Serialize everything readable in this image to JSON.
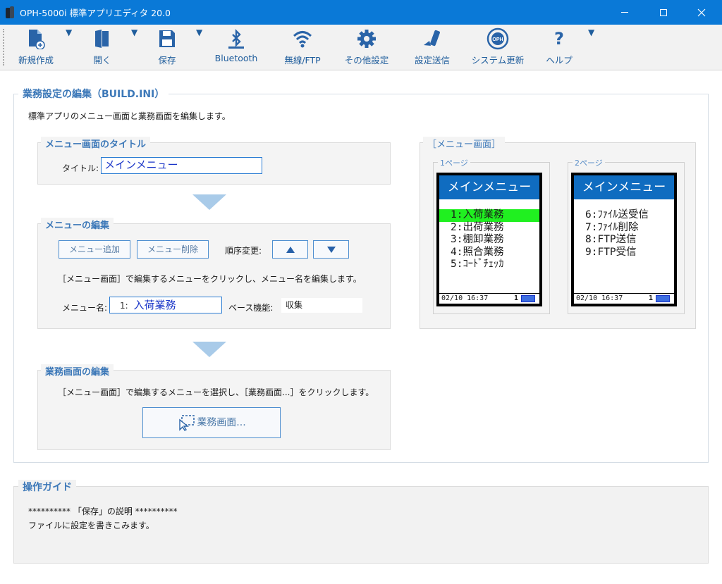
{
  "window": {
    "title": "OPH-5000i 標準アプリエディタ 20.0"
  },
  "toolbar": {
    "items": [
      {
        "label": "新規作成",
        "icon": "new-file-icon"
      },
      {
        "label": "開く",
        "icon": "open-icon"
      },
      {
        "label": "保存",
        "icon": "save-icon"
      },
      {
        "label": "Bluetooth",
        "icon": "bluetooth-icon"
      },
      {
        "label": "無線/FTP",
        "icon": "wifi-icon"
      },
      {
        "label": "その他設定",
        "icon": "gear-icon"
      },
      {
        "label": "設定送信",
        "icon": "send-icon"
      },
      {
        "label": "システム更新",
        "icon": "system-update-icon"
      },
      {
        "label": "ヘルプ",
        "icon": "help-icon"
      }
    ]
  },
  "main": {
    "title": "業務設定の編集（BUILD.INI）",
    "description": "標準アプリのメニュー画面と業務画面を編集します。"
  },
  "menu_title_section": {
    "title": "メニュー画面のタイトル",
    "label": "タイトル:",
    "value": "メインメニュー"
  },
  "menu_edit_section": {
    "title": "メニューの編集",
    "add_label": "メニュー追加",
    "delete_label": "メニュー削除",
    "order_label": "順序変更:",
    "instruction": "［メニュー画面］で編集するメニューをクリックし、メニュー名を編集します。",
    "name_label": "メニュー名:",
    "name_index": "1:",
    "name_value": "入荷業務",
    "base_label": "ベース機能:",
    "base_value": "収集"
  },
  "work_screen_section": {
    "title": "業務画面の編集",
    "instruction": "［メニュー画面］で編集するメニューを選択し、［業務画面...］をクリックします。",
    "button_label": "業務画面..."
  },
  "preview": {
    "title": "［メニュー画面］",
    "pages": [
      {
        "label": "1ページ",
        "header": "メインメニュー",
        "items": [
          "1:入荷業務",
          "2:出荷業務",
          "3:棚卸業務",
          "4:照合業務",
          "5:ｺｰﾄﾞﾁｪｯｶ"
        ],
        "footer": "02/10 16:37",
        "indicator": "1"
      },
      {
        "label": "2ページ",
        "header": "メインメニュー",
        "items": [
          "6:ﾌｧｲﾙ送受信",
          "7:ﾌｧｲﾙ削除",
          "8:FTP送信",
          "9:FTP受信"
        ],
        "footer": "02/10 16:37",
        "indicator": "1"
      }
    ]
  },
  "guide": {
    "title": "操作ガイド",
    "line1": "********** 「保存」の説明 **********",
    "line2": "ファイルに設定を書きこみます。"
  },
  "colors": {
    "accent": "#0a79d7",
    "label_blue": "#3c78b8",
    "selected": "#20f020"
  }
}
